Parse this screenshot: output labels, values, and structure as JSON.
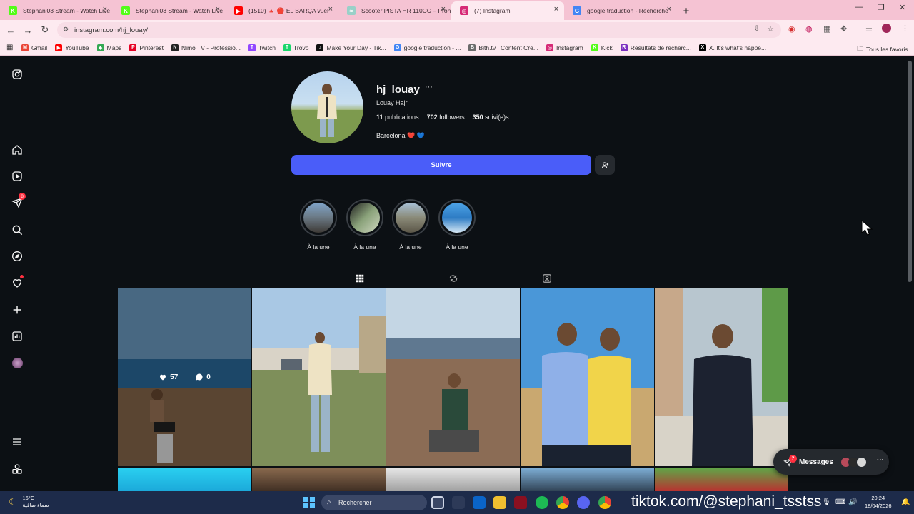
{
  "browser": {
    "tabs": [
      {
        "title": "Stephani03 Stream - Watch Live",
        "favicon": "kick-icon",
        "color": "#53fc18",
        "glyph": "K"
      },
      {
        "title": "Stephani03 Stream - Watch Live",
        "favicon": "kick-icon",
        "color": "#53fc18",
        "glyph": "K"
      },
      {
        "title": "(1510) 🔺 🔴 EL BARÇA vuel",
        "favicon": "youtube-icon",
        "color": "#ff0000",
        "glyph": "▶"
      },
      {
        "title": "Scooter PISTA HR 110CC – Pron",
        "favicon": "site-icon",
        "color": "#9ad0c8",
        "glyph": "≈"
      },
      {
        "title": "(7) Instagram",
        "favicon": "instagram-icon",
        "color": "#d62976",
        "glyph": "◎",
        "active": true
      },
      {
        "title": "google traduction - Recherche",
        "favicon": "google-icon",
        "color": "#4285f4",
        "glyph": "G"
      }
    ],
    "new_tab": "+",
    "url": "instagram.com/hj_louay/",
    "bookmarks": [
      {
        "label": "Gmail",
        "icon": "gmail-icon",
        "color": "#ea4335",
        "glyph": "M"
      },
      {
        "label": "YouTube",
        "icon": "youtube-icon",
        "color": "#ff0000",
        "glyph": "▶"
      },
      {
        "label": "Maps",
        "icon": "maps-icon",
        "color": "#34a853",
        "glyph": "◆"
      },
      {
        "label": "Pinterest",
        "icon": "pinterest-icon",
        "color": "#e60023",
        "glyph": "P"
      },
      {
        "label": "Nimo TV - Professio...",
        "icon": "nimo-icon",
        "color": "#222222",
        "glyph": "N"
      },
      {
        "label": "Twitch",
        "icon": "twitch-icon",
        "color": "#9146ff",
        "glyph": "T"
      },
      {
        "label": "Trovo",
        "icon": "trovo-icon",
        "color": "#19d66b",
        "glyph": "T"
      },
      {
        "label": "Make Your Day - Tik...",
        "icon": "tiktok-icon",
        "color": "#111111",
        "glyph": "♪"
      },
      {
        "label": "google traduction - ...",
        "icon": "google-icon",
        "color": "#4285f4",
        "glyph": "G"
      },
      {
        "label": "Bith.tv | Content Cre...",
        "icon": "bith-icon",
        "color": "#6b6b6b",
        "glyph": "B"
      },
      {
        "label": "Instagram",
        "icon": "instagram-icon",
        "color": "#d62976",
        "glyph": "◎"
      },
      {
        "label": "Kick",
        "icon": "kick-icon",
        "color": "#53fc18",
        "glyph": "K"
      },
      {
        "label": "Résultats de recherc...",
        "icon": "search-result-icon",
        "color": "#7b2fbf",
        "glyph": "R"
      },
      {
        "label": "X. It's what's happe...",
        "icon": "x-icon",
        "color": "#000000",
        "glyph": "X"
      }
    ],
    "all_favorites": "Tous les favoris"
  },
  "sidebar": {
    "badge_notifications": "8"
  },
  "profile": {
    "username": "hj_louay",
    "full_name": "Louay Hajri",
    "posts_count": "11",
    "posts_label": "publications",
    "followers_count": "702",
    "followers_label": "followers",
    "following_count": "350",
    "following_label": "suivi(e)s",
    "bio": "Barcelona ❤️ 💙",
    "follow_button": "Suivre"
  },
  "highlights": [
    {
      "label": "À la une"
    },
    {
      "label": "À la une"
    },
    {
      "label": "À la une"
    },
    {
      "label": "À la une"
    }
  ],
  "posts": [
    {
      "likes": "57",
      "comments": "0",
      "hovered": true
    }
  ],
  "messages": {
    "label": "Messages",
    "badge": "7"
  },
  "taskbar": {
    "temperature": "16°C",
    "weather_text": "سماء صافية",
    "search_label": "Rechercher",
    "overlay": "tiktok.com/@stephani_tsstss",
    "time": "20:24",
    "date": "18/04/2026"
  }
}
